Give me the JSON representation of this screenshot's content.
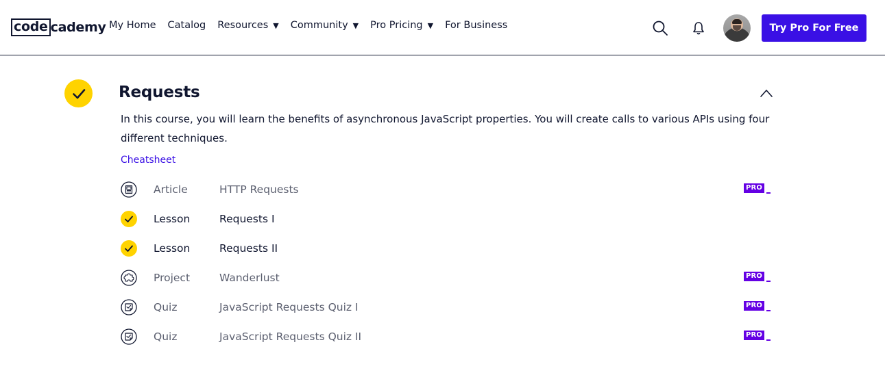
{
  "header": {
    "logo_box": "code",
    "logo_rest": "cademy",
    "nav": [
      {
        "label": "My Home",
        "has_caret": false
      },
      {
        "label": "Catalog",
        "has_caret": false
      },
      {
        "label": "Resources",
        "has_caret": true
      },
      {
        "label": "Community",
        "has_caret": true
      },
      {
        "label": "Pro Pricing",
        "has_caret": true
      },
      {
        "label": "For Business",
        "has_caret": false
      }
    ],
    "caret_glyph": "▼",
    "icons": [
      "search-icon",
      "bell-icon"
    ],
    "cta_label": "Try Pro For Free"
  },
  "section": {
    "title": "Requests",
    "status": "completed",
    "description": "In this course, you will learn the benefits of asynchronous JavaScript properties. You will create calls to various APIs using four different techniques.",
    "cheatsheet_label": "Cheatsheet",
    "items": [
      {
        "type": "Article",
        "name": "HTTP Requests",
        "icon": "article-icon",
        "completed": false,
        "pro": true
      },
      {
        "type": "Lesson",
        "name": "Requests I",
        "icon": "check-icon",
        "completed": true,
        "pro": false
      },
      {
        "type": "Lesson",
        "name": "Requests II",
        "icon": "check-icon",
        "completed": true,
        "pro": false
      },
      {
        "type": "Project",
        "name": "Wanderlust",
        "icon": "puzzle-icon",
        "completed": false,
        "pro": true
      },
      {
        "type": "Quiz",
        "name": "JavaScript Requests Quiz I",
        "icon": "quiz-icon",
        "completed": false,
        "pro": true
      },
      {
        "type": "Quiz",
        "name": "JavaScript Requests Quiz II",
        "icon": "quiz-icon",
        "completed": false,
        "pro": true
      }
    ],
    "pro_badge_label": "PRO"
  },
  "colors": {
    "accent": "#3a10e5",
    "check_yellow": "#ffd300",
    "pro_purple": "#6400e4",
    "text_dark": "#10162f",
    "text_muted": "#5b5f6f"
  }
}
